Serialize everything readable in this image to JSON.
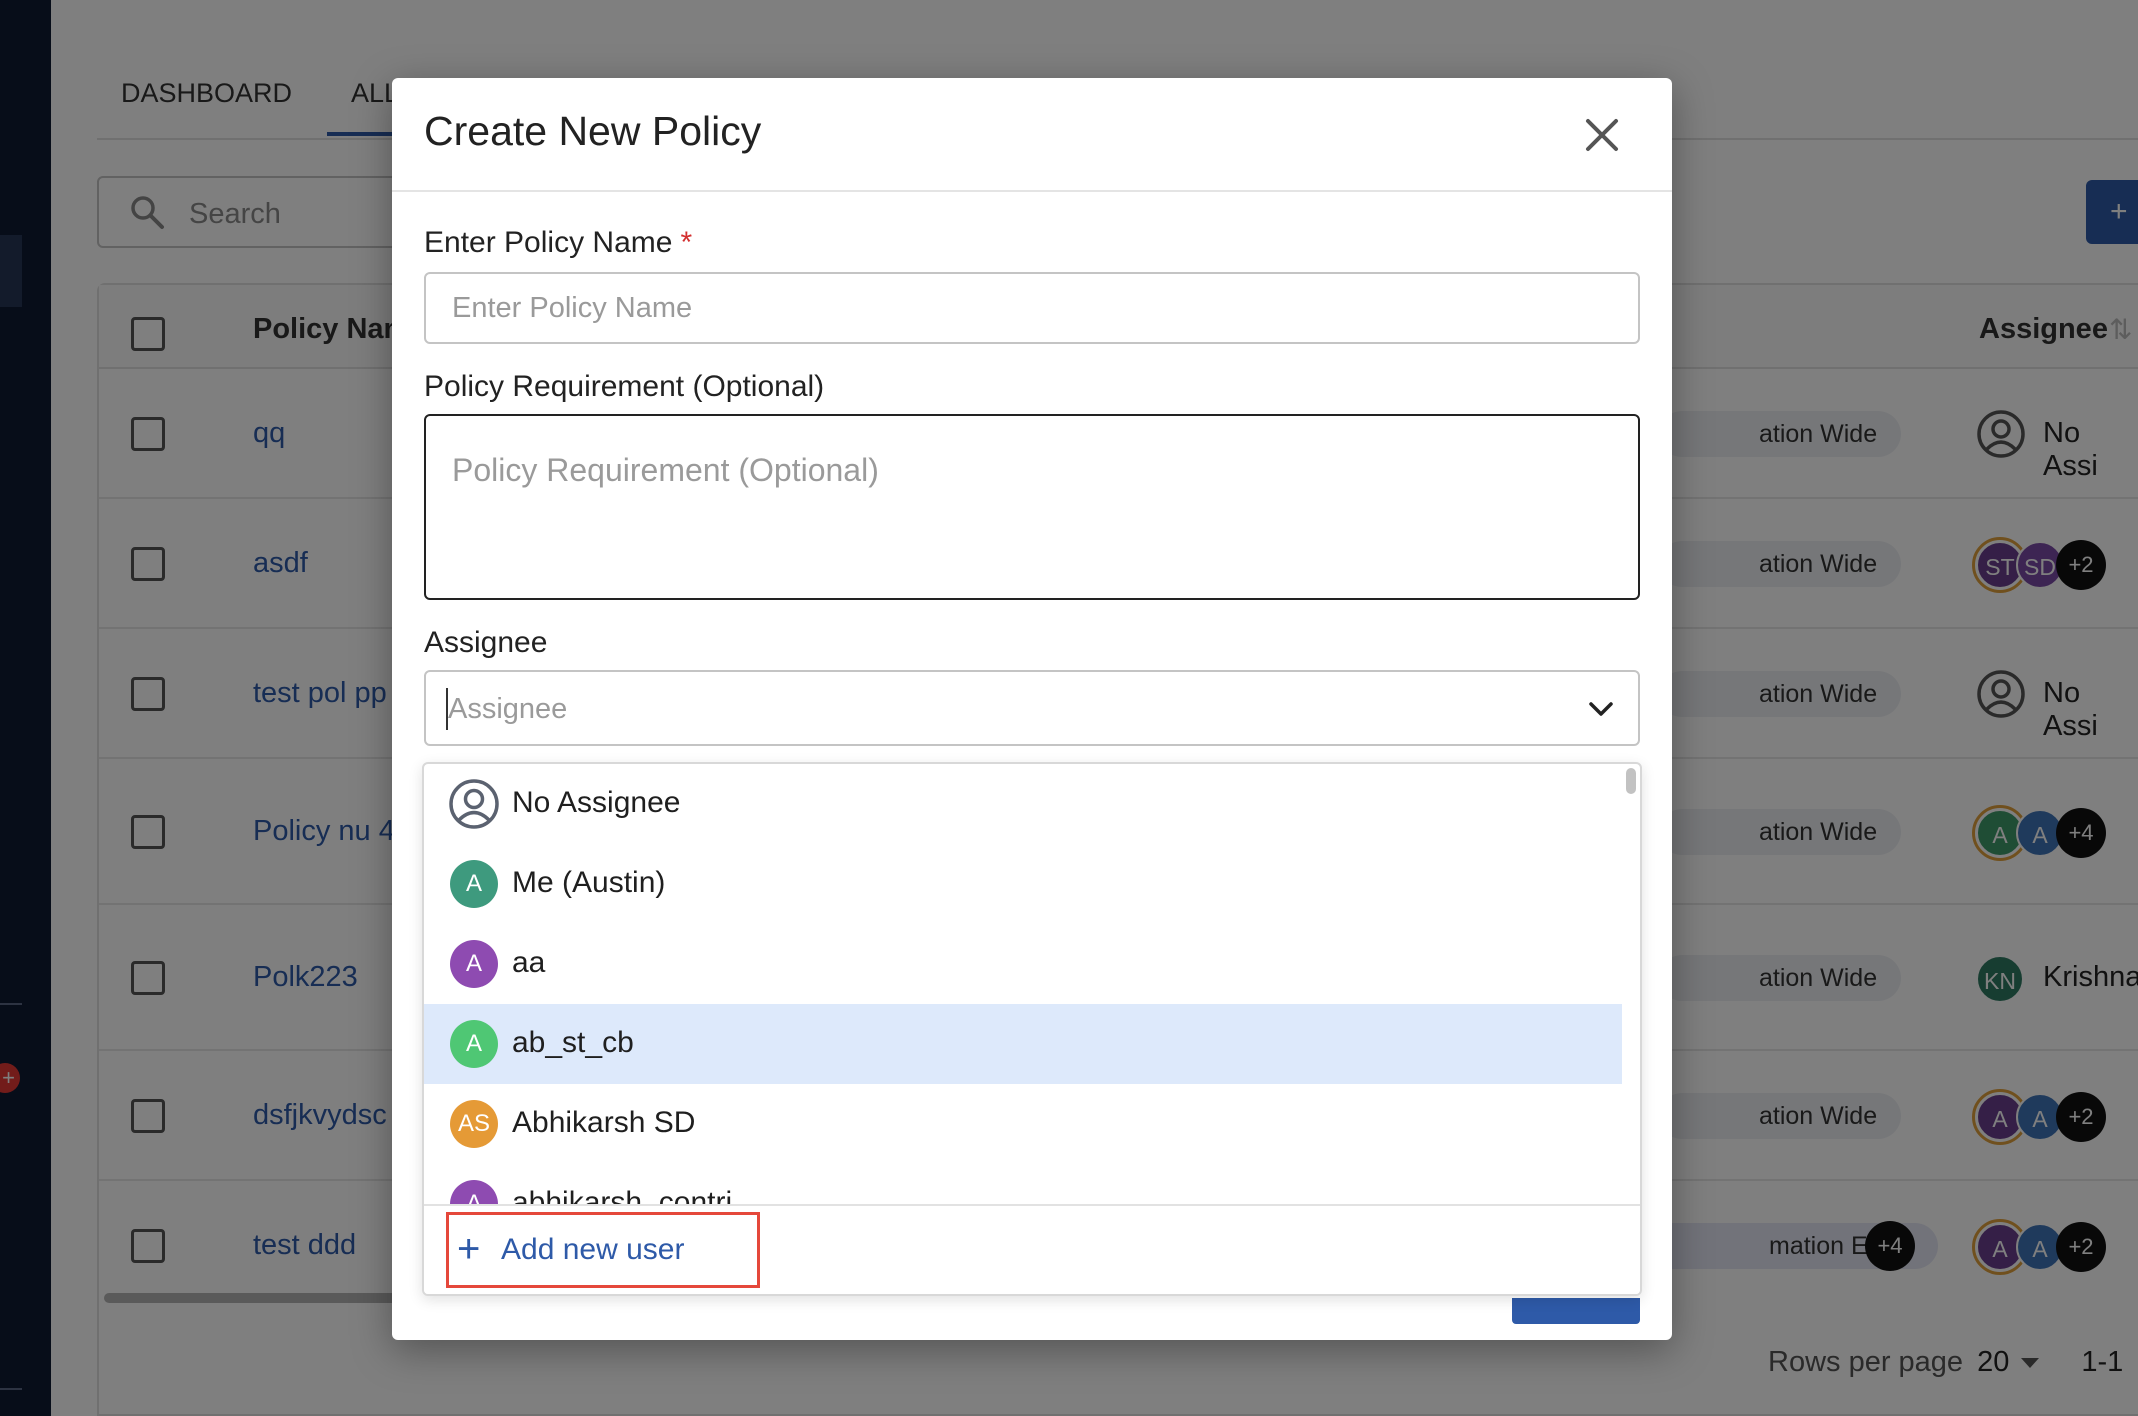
{
  "tabs": [
    {
      "label": "DASHBOARD"
    },
    {
      "label": "ALL"
    }
  ],
  "search": {
    "placeholder": "Search"
  },
  "add_button": {
    "label": "+"
  },
  "table": {
    "headers": {
      "name": "Policy Nam",
      "assignee": "Assignee",
      "sort_icon": "sort-icon"
    },
    "rows": [
      {
        "name": "qq",
        "scope": "ation Wide",
        "assignee_text": "No Assi",
        "avatars": []
      },
      {
        "name": "asdf",
        "scope": "ation Wide",
        "assignee_text": "",
        "avatars": [
          "ST",
          "SD"
        ],
        "extra": "+2"
      },
      {
        "name": "test pol pp",
        "scope": "ation Wide",
        "assignee_text": "No Assi",
        "avatars": []
      },
      {
        "name": "Policy nu 4",
        "scope": "ation Wide",
        "assignee_text": "",
        "avatars": [
          "A",
          "A"
        ],
        "extra": "+4"
      },
      {
        "name": "Polk223",
        "scope": "ation Wide",
        "assignee_text": "Krishna",
        "avatars": [
          "KN"
        ]
      },
      {
        "name": "dsfjkvydsc",
        "scope": "ation Wide",
        "assignee_text": "",
        "avatars": [
          "A",
          "A"
        ],
        "extra": "+2"
      },
      {
        "name": "test ddd",
        "scope": "mation Entity",
        "scope_extra": "+4",
        "assignee_text": "",
        "avatars": [
          "A",
          "A"
        ],
        "extra": "+2"
      }
    ]
  },
  "pagination": {
    "rows_label": "Rows per page",
    "rows_value": "20",
    "range": "1-1"
  },
  "sidebar": {
    "badge": "+"
  },
  "modal": {
    "title": "Create New Policy",
    "close_icon": "close-icon",
    "policy_name": {
      "label": "Enter Policy Name",
      "required_mark": "*",
      "placeholder": "Enter Policy Name",
      "value": ""
    },
    "requirement": {
      "label": "Policy Requirement (Optional)",
      "placeholder": "Policy Requirement (Optional)",
      "value": ""
    },
    "assignee": {
      "label": "Assignee",
      "placeholder": "Assignee",
      "value": "",
      "chevron_icon": "chevron-down-icon"
    }
  },
  "dropdown": {
    "options": [
      {
        "label": "No Assignee",
        "initials": "",
        "icon": "user-circle-icon",
        "color": ""
      },
      {
        "label": "Me (Austin)",
        "initials": "A",
        "color": "#3e9a7e"
      },
      {
        "label": "aa",
        "initials": "A",
        "color": "#8e4bb1"
      },
      {
        "label": "ab_st_cb",
        "initials": "A",
        "color": "#4fc774",
        "highlighted": true
      },
      {
        "label": "Abhikarsh SD",
        "initials": "AS",
        "color": "#e59a36"
      },
      {
        "label": "abhikarsh_contri",
        "initials": "A",
        "color": "#8e4bb1"
      }
    ],
    "add_new_user": {
      "label": "Add new user",
      "icon": "plus-icon"
    }
  },
  "colors": {
    "primary": "#2e5aa8",
    "highlight": "#dde9fb",
    "required": "#d32f2f",
    "callout": "#e5483b"
  }
}
